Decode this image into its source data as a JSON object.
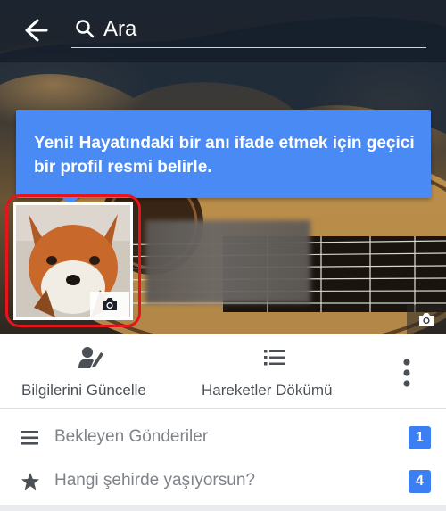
{
  "search": {
    "placeholder": "Ara",
    "search_icon": "search-icon",
    "back_icon": "arrow-left-icon"
  },
  "tooltip": {
    "text": "Yeni! Hayatındaki bir anı ifade etmek için geçici bir profil resmi belirle."
  },
  "profile": {
    "picture_alt": "fox",
    "camera_icon": "camera-icon"
  },
  "cover": {
    "camera_icon": "camera-icon"
  },
  "actions": [
    {
      "label": "Bilgilerini Güncelle",
      "icon": "edit-profile-icon"
    },
    {
      "label": "Hareketler Dökümü",
      "icon": "list-icon"
    },
    {
      "label": "",
      "icon": "more-vertical-icon"
    }
  ],
  "list": [
    {
      "label": "Bekleyen Gönderiler",
      "icon": "menu-lines-icon",
      "badge": "1"
    },
    {
      "label": "Hangi şehirde yaşıyorsun?",
      "icon": "star-icon",
      "badge": "4"
    }
  ],
  "colors": {
    "accent": "#4a8af4",
    "badge": "#3b7ff2",
    "highlight_ring": "#e8141b"
  }
}
